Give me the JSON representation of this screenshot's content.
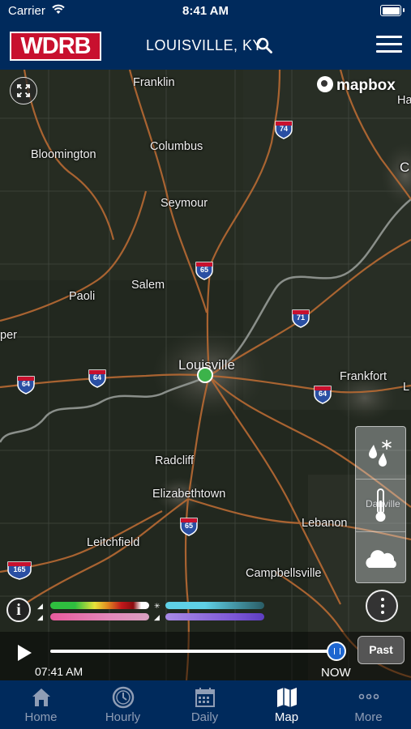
{
  "status_bar": {
    "carrier": "Carrier",
    "time": "8:41 AM"
  },
  "header": {
    "logo": "WDRB",
    "location": "LOUISVILLE, KY"
  },
  "map": {
    "attribution": "mapbox",
    "cities": [
      {
        "name": "Franklin"
      },
      {
        "name": "Columbus"
      },
      {
        "name": "Bloomington"
      },
      {
        "name": "Seymour"
      },
      {
        "name": "Salem"
      },
      {
        "name": "Paoli"
      },
      {
        "name": "Louisville"
      },
      {
        "name": "Frankfort"
      },
      {
        "name": "Radcliff"
      },
      {
        "name": "Elizabethtown"
      },
      {
        "name": "Lebanon"
      },
      {
        "name": "Danville"
      },
      {
        "name": "Leitchfield"
      },
      {
        "name": "Campbellsville"
      },
      {
        "name": "Ha"
      },
      {
        "name": "C"
      },
      {
        "name": "per"
      },
      {
        "name": "L"
      }
    ],
    "highways": [
      "74",
      "65",
      "71",
      "64",
      "64",
      "64",
      "65",
      "165"
    ],
    "layers": [
      "precipitation-layer",
      "temperature-layer",
      "clouds-layer"
    ]
  },
  "timeline": {
    "start_time": "07:41 AM",
    "end_label": "NOW",
    "past_label": "Past",
    "progress": 1.0
  },
  "tabs": [
    {
      "label": "Home"
    },
    {
      "label": "Hourly"
    },
    {
      "label": "Daily"
    },
    {
      "label": "Map"
    },
    {
      "label": "More"
    }
  ],
  "active_tab": "Map",
  "colors": {
    "brand_navy": "#002a5c",
    "logo_red": "#c8102e",
    "location_dot": "#3cb34a",
    "slider_thumb": "#1e66d0"
  }
}
